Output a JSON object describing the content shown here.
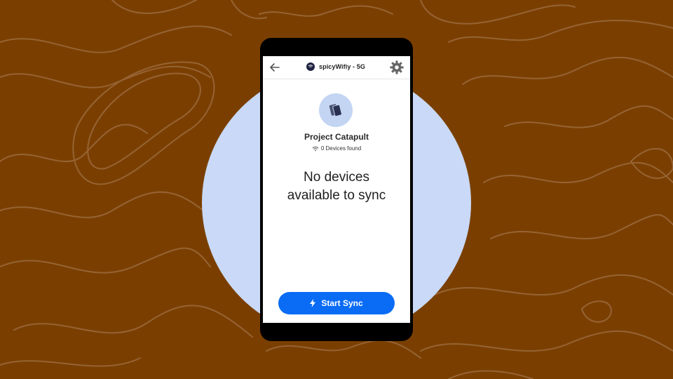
{
  "colors": {
    "background": "#7a3f00",
    "contour_lines": "#9b6a3f",
    "blob": "#c9d9f7",
    "accent": "#0a6cf5",
    "project_icon_bg": "#c3d5f3"
  },
  "header": {
    "back_icon": "arrow-left-icon",
    "network_icon": "wifi-dot-icon",
    "network_name": "spicyWifiy - 5G",
    "settings_icon": "gear-icon"
  },
  "project": {
    "icon": "devices-stack-icon",
    "title": "Project Catapult",
    "devices_icon": "wifi-icon",
    "devices_found": "0 Devices found"
  },
  "message": {
    "line1": "No devices",
    "line2": "available to sync"
  },
  "action": {
    "icon": "lightning-icon",
    "label": "Start Sync"
  }
}
